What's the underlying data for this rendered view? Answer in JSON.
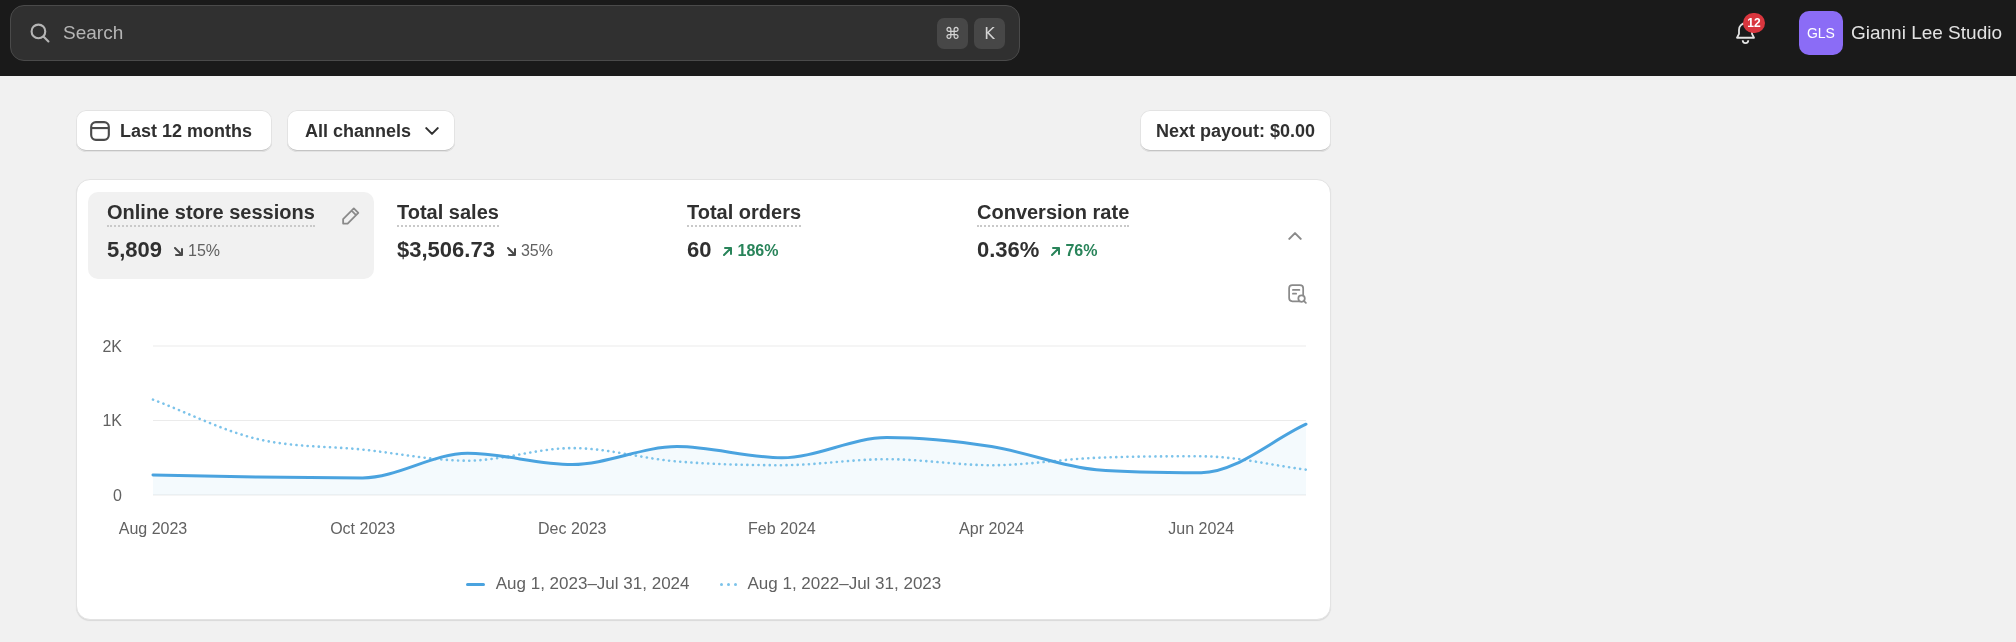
{
  "top_bar": {
    "search": {
      "placeholder": "Search",
      "shortcut_keys": [
        "⌘",
        "K"
      ]
    },
    "notifications": {
      "count": "12"
    },
    "account": {
      "initials": "GLS",
      "name": "Gianni Lee Studio"
    }
  },
  "filters": {
    "date_range": "Last 12 months",
    "channels": "All channels",
    "payout": "Next payout: $0.00"
  },
  "metrics_card": {
    "expanded": true,
    "metrics": [
      {
        "title": "Online store sessions",
        "value": "5,809",
        "change": "15%",
        "kind": "down",
        "selected": true
      },
      {
        "title": "Total sales",
        "value": "$3,506.73",
        "change": "35%",
        "kind": "down",
        "selected": false
      },
      {
        "title": "Total orders",
        "value": "60",
        "change": "186%",
        "kind": "up",
        "selected": false
      },
      {
        "title": "Conversion rate",
        "value": "0.36%",
        "change": "76%",
        "kind": "up",
        "selected": false
      }
    ],
    "chart_data": {
      "type": "line",
      "categories": [
        "Aug 2023",
        null,
        "Oct 2023",
        null,
        "Dec 2023",
        null,
        "Feb 2024",
        null,
        "Apr 2024",
        null,
        "Jun 2024",
        null
      ],
      "ylim": [
        0,
        2000
      ],
      "yticks": [
        {
          "value": 0,
          "label": "0"
        },
        {
          "value": 1000,
          "label": "1K"
        },
        {
          "value": 2000,
          "label": "2K"
        }
      ],
      "series": [
        {
          "name": "Aug 1, 2023–Jul 31, 2024",
          "color": "#4aa3df",
          "line_style": "solid",
          "values": [
            270,
            240,
            230,
            560,
            410,
            650,
            500,
            770,
            650,
            340,
            300,
            950
          ]
        },
        {
          "name": "Aug 1, 2022–Jul 31, 2023",
          "color": "#7cc3ea",
          "line_style": "dotted",
          "values": [
            1280,
            750,
            610,
            460,
            630,
            450,
            400,
            480,
            400,
            500,
            520,
            340
          ]
        }
      ]
    }
  }
}
